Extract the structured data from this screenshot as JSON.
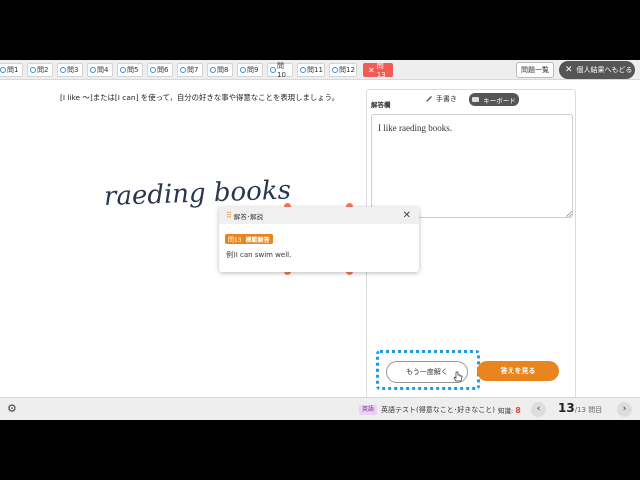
{
  "tabs": [
    {
      "label": "問1"
    },
    {
      "label": "問2"
    },
    {
      "label": "問3"
    },
    {
      "label": "問4"
    },
    {
      "label": "問5"
    },
    {
      "label": "問6"
    },
    {
      "label": "問7"
    },
    {
      "label": "問8"
    },
    {
      "label": "問9"
    },
    {
      "label": "問10"
    },
    {
      "label": "問11"
    },
    {
      "label": "問12"
    },
    {
      "label": "問13"
    }
  ],
  "header": {
    "list_button": "問題一覧",
    "back_button": "個人結果へもどる"
  },
  "question": {
    "prompt": "[I like ～]または[I can] を使って，自分の好きな事や得意なことを表現しましょう。",
    "handwriting": "raeding books"
  },
  "answer_panel": {
    "label": "解答欄",
    "handwriting_tab": "手書き",
    "keyboard_tab": "キーボード",
    "answer_text": "I like raeding books.",
    "retry_button": "もう一度解く",
    "show_answer_button": "答えを見る"
  },
  "popup": {
    "title": "解答･解説",
    "badge_number": "問13",
    "badge_label": "模範解答",
    "example": "例)I can swim well."
  },
  "footer": {
    "subject": "英語",
    "test_title": "英語テスト(得意なこと･好きなこと)",
    "knowledge_label": "知識:",
    "knowledge_value": "8",
    "current": "13",
    "total": "/13",
    "suffix": "問目"
  },
  "colors": {
    "active_tab": "#f25c54",
    "accent": "#e8851e",
    "focus_dots": "#1e9ae6"
  }
}
